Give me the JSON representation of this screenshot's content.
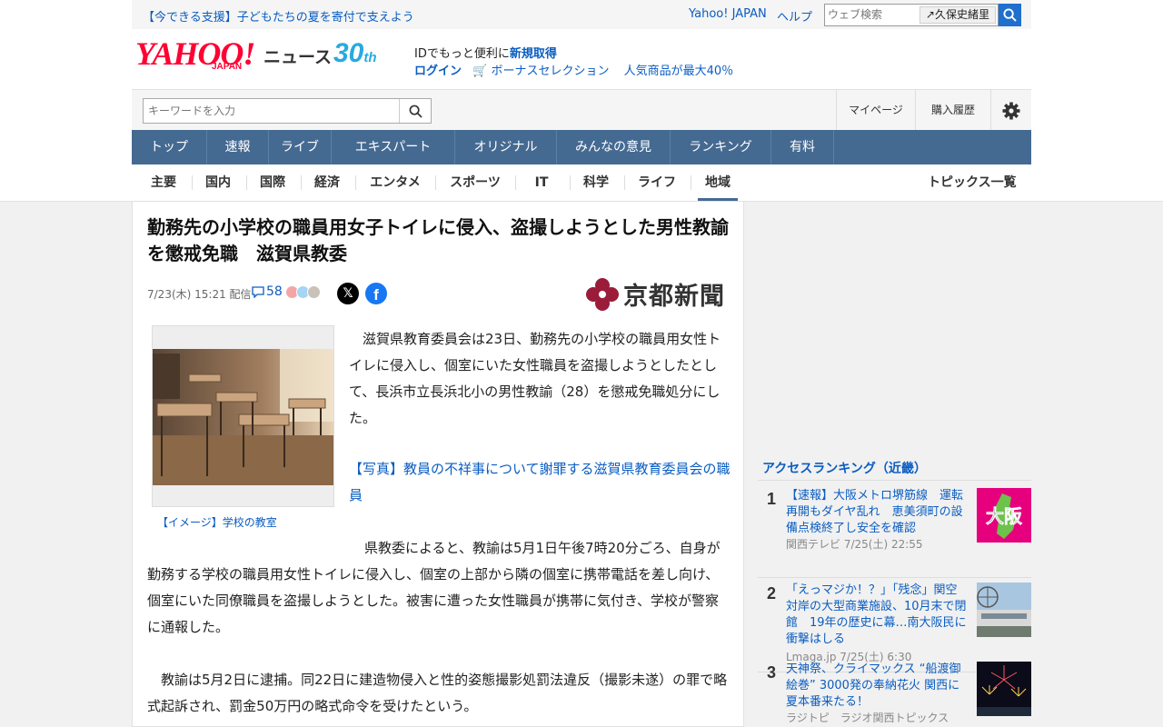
{
  "utility": {
    "promo": "【今できる支援】子どもたちの夏を寄付で支えよう",
    "yahoo_japan": "Yahoo! JAPAN",
    "help": "ヘルプ",
    "search_placeholder": "ウェブ検索",
    "suggest": "久保史緒里"
  },
  "header": {
    "logo": "YAHOO!",
    "logo_sub": "JAPAN",
    "news": "ニュース",
    "anniv": "30",
    "anniv_suffix": "th",
    "id_text": "IDでもっと便利に",
    "id_link": "新規取得",
    "login": "ログイン",
    "bonus": "ボーナスセレクション",
    "popular": "人気商品が最大40％"
  },
  "search": {
    "placeholder": "キーワードを入力",
    "mypage": "マイページ",
    "history": "購入履歴"
  },
  "main_nav": [
    {
      "label": "トップ",
      "active": true
    },
    {
      "label": "速報"
    },
    {
      "label": "ライブ"
    },
    {
      "label": "エキスパート"
    },
    {
      "label": "オリジナル"
    },
    {
      "label": "みんなの意見"
    },
    {
      "label": "ランキング"
    },
    {
      "label": "有料"
    }
  ],
  "sub_nav": [
    {
      "label": "主要"
    },
    {
      "label": "国内"
    },
    {
      "label": "国際"
    },
    {
      "label": "経済"
    },
    {
      "label": "エンタメ"
    },
    {
      "label": "スポーツ"
    },
    {
      "label": "IT"
    },
    {
      "label": "科学"
    },
    {
      "label": "ライフ"
    },
    {
      "label": "地域",
      "active": true
    }
  ],
  "topics_all": "トピックス一覧",
  "article": {
    "headline": "勤務先の小学校の職員用女子トイレに侵入、盗撮しようとした男性教諭を懲戒免職　滋賀県教委",
    "date": "7/23(木) 15:21",
    "delivered": "配信",
    "comments": "58",
    "x": "𝕏",
    "fb": "f",
    "publisher": "京都新聞",
    "caption": "【イメージ】学校の教室",
    "p1": "滋賀県教育委員会は23日、勤務先の小学校の職員用女性トイレに侵入し、個室にいた女性職員を盗撮しようとしたとして、長浜市立長浜北小の男性教諭（28）を懲戒免職処分にした。",
    "photo_link": "【写真】教員の不祥事について謝罪する滋賀県教育委員会の職員",
    "p2": "県教委によると、教諭は5月1日午後7時20分ごろ、自身が勤務する学校の職員用女性トイレに侵入し、個室の上部から隣の個室に携帯電話を差し向け、個室にいた同僚職員を盗撮しようとした。被害に遭った女性職員が携帯に気付き、学校が警察に通報した。",
    "p3": "教諭は5月2日に逮捕。同22日に建造物侵入と性的姿態撮影処罰法違反（撮影未遂）の罪で略式起訴され、罰金50万円の略式命令を受けたという。"
  },
  "ranking": {
    "title": "アクセスランキング（近畿）",
    "items": [
      {
        "rank": "1",
        "title": "【速報】大阪メトロ堺筋線　運転再開もダイヤ乱れ　恵美須町の設備点検終了し安全を確認",
        "source": "関西テレビ 7/25(土) 22:55",
        "thumb_text": "大阪"
      },
      {
        "rank": "2",
        "title": "「えっマジか！？」「残念」関空対岸の大型商業施設、10月末で閉館　19年の歴史に幕…南大阪民に衝撃はしる",
        "source": "Lmaga.jp 7/25(土) 6:30"
      },
      {
        "rank": "3",
        "title": "天神祭、クライマックス “船渡御絵巻” 3000発の奉納花火 関西に夏本番来たる！",
        "source": "ラジトピ　ラジオ関西トピックス"
      }
    ]
  },
  "colors": {
    "nav_bg": "#456a92",
    "nav_active": "#333d4e",
    "link": "#0a5dc2",
    "logo_red": "#ff0033"
  }
}
